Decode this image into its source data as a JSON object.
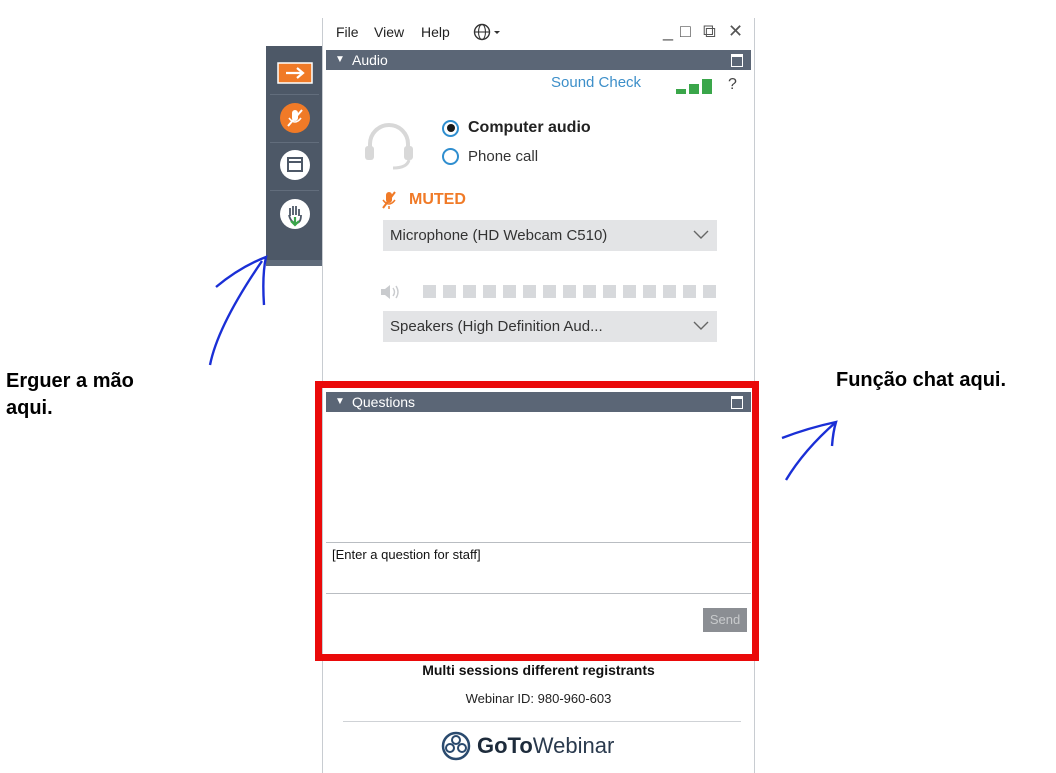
{
  "menu": {
    "file": "File",
    "view": "View",
    "help": "Help",
    "language_icon": "globe-icon"
  },
  "window_controls": {
    "minimize": "_",
    "restore": "□",
    "popout": "⧉",
    "close": "✕"
  },
  "audio": {
    "title": "Audio",
    "sound_check": "Sound Check",
    "help": "?",
    "computer_audio": "Computer audio",
    "phone_call": "Phone call",
    "muted": "MUTED",
    "microphone": "Microphone (HD Webcam C510)",
    "speakers": "Speakers (High Definition Aud..."
  },
  "questions": {
    "title": "Questions",
    "placeholder": "[Enter a question for staff]",
    "send": "Send"
  },
  "footer": {
    "session": "Multi sessions different registrants",
    "webinar_id": "Webinar ID: 980-960-603",
    "brand_goto": "GoTo",
    "brand_webinar": "Webinar"
  },
  "annotations": {
    "left_line1": "Erguer a mão",
    "left_line2": "aqui.",
    "right": "Função chat aqui."
  },
  "colors": {
    "accent_orange": "#f07a27",
    "header_gray": "#5b6676",
    "link_blue": "#3d8fc9",
    "highlight_red": "#ea0a0a",
    "annotation_blue": "#1a2fd6"
  }
}
